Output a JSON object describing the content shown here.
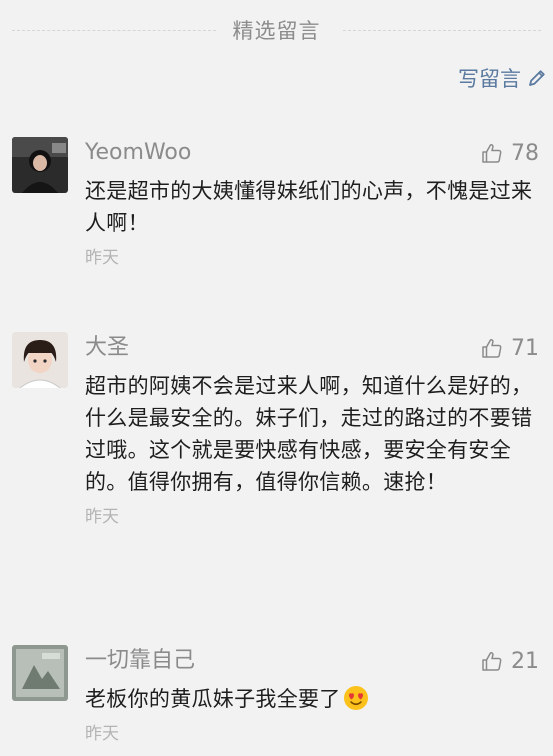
{
  "section": {
    "title": "精选留言"
  },
  "write_button": {
    "label": "写留言",
    "icon": "pencil-icon"
  },
  "colors": {
    "link": "#5b7aa0",
    "meta": "#8b8b8b",
    "time": "#b4b4b4",
    "background": "#f2f2f2"
  },
  "comments": [
    {
      "username": "YeomWoo",
      "likes": "78",
      "text": "还是超市的大姨懂得妹纸们的心声，不愧是过来人啊！",
      "time": "昨天"
    },
    {
      "username": "大圣",
      "likes": "71",
      "text": "超市的阿姨不会是过来人啊，知道什么是好的，什么是最安全的。妹子们，走过的路过的不要错过哦。这个就是要快感有快感，要安全有安全的。值得你拥有，值得你信赖。速抢！",
      "time": "昨天"
    },
    {
      "username": "一切靠自己",
      "likes": "21",
      "text": "老板你的黄瓜妹子我全要了",
      "emoji": "heart-eyes-emoji",
      "time": "昨天"
    }
  ]
}
